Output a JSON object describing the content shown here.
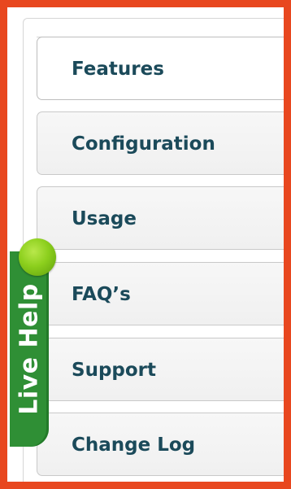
{
  "tabs": [
    {
      "label": "Features"
    },
    {
      "label": "Configuration"
    },
    {
      "label": "Usage"
    },
    {
      "label": "FAQ’s"
    },
    {
      "label": "Support"
    },
    {
      "label": "Change Log"
    }
  ],
  "live_help": {
    "label": "Live Help",
    "status_color": "#8ccf1d",
    "widget_color": "#2f8f35"
  },
  "colors": {
    "frame_border": "#e8471f",
    "tab_text": "#1b4a5a"
  }
}
